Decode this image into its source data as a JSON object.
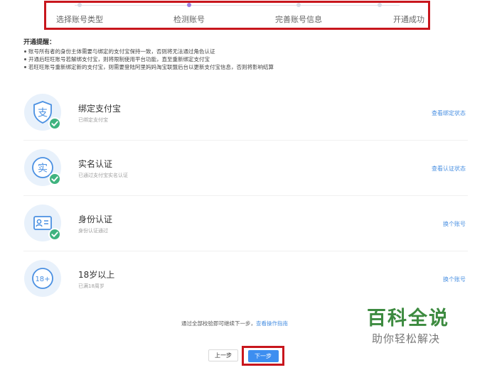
{
  "steps": [
    {
      "label": "选择账号类型"
    },
    {
      "label": "检测账号"
    },
    {
      "label": "完善账号信息"
    },
    {
      "label": "开通成功"
    }
  ],
  "notice": {
    "title": "开通提醒：",
    "items": [
      "账号所有者的身份主体需要与绑定的支付宝保持一致，否则将无法通过角色认证",
      "开通后旺旺账号若解绑支付宝，则将限制使用平台功能，直至重新绑定支付宝",
      "若旺旺账号重新绑定新的支付宝，则需要登陆阿里妈妈淘宝联盟后台以更新支付宝信息，否则将影响结算"
    ]
  },
  "verifications": [
    {
      "title": "绑定支付宝",
      "desc": "已绑定支付宝",
      "action": "查看绑定状态",
      "icon": "alipay-icon",
      "glyph": "支"
    },
    {
      "title": "实名认证",
      "desc": "已通过支付宝实名认证",
      "action": "查看认证状态",
      "icon": "realname-icon",
      "glyph": "实"
    },
    {
      "title": "身份认证",
      "desc": "身份认证通过",
      "action": "换个账号",
      "icon": "id-card-icon",
      "glyph": ""
    },
    {
      "title": "18岁以上",
      "desc": "已满18周岁",
      "action": "换个账号",
      "icon": "age-18-icon",
      "glyph": "18+"
    }
  ],
  "footer": {
    "hint": "通过全部校验即可继续下一步，",
    "guide_link": "查看操作指南",
    "prev_label": "上一步",
    "next_label": "下一步"
  },
  "watermark": {
    "title": "百科全说",
    "subtitle": "助你轻松解决"
  },
  "colors": {
    "accent": "#4a90e2",
    "success": "#3fb37f",
    "highlight_border": "#c8161d",
    "primary_button": "#3d8ef0",
    "badge_bg": "#e8f1fb"
  }
}
